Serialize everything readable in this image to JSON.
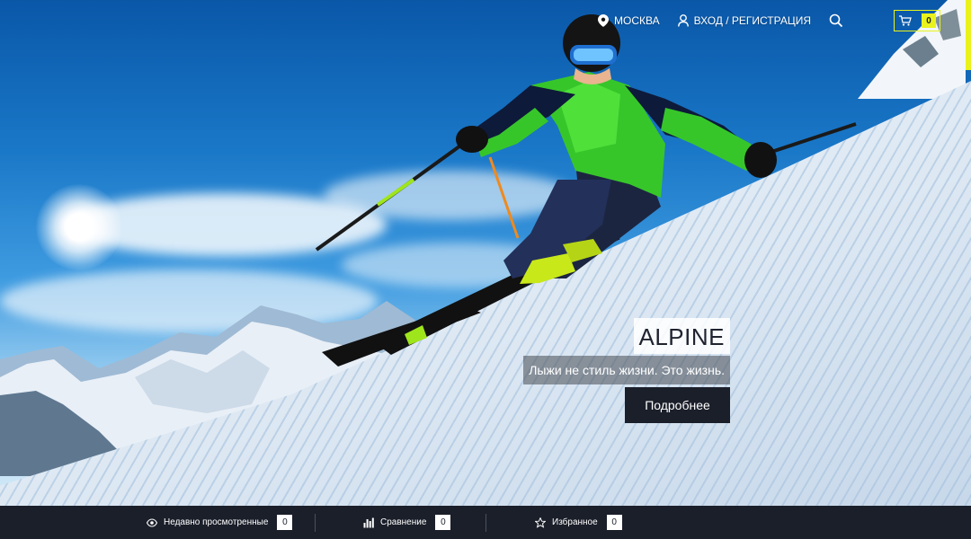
{
  "header": {
    "city": "МОСКВА",
    "login": "ВХОД / РЕГИСТРАЦИЯ",
    "cart_count": "0",
    "icons": [
      "location-pin-icon",
      "user-icon",
      "search-icon",
      "cart-icon"
    ],
    "accent_color": "#e9f21c"
  },
  "promo": {
    "title": "ALPINE",
    "subtitle": "Лыжи не стиль жизни. Это жизнь.",
    "button": "Подробнее"
  },
  "bottom_bar": {
    "background": "#1b1f2a",
    "items": [
      {
        "icon": "eye-icon",
        "label": "Недавно просмотренные",
        "count": "0"
      },
      {
        "icon": "bar-chart-icon",
        "label": "Сравнение",
        "count": "0"
      },
      {
        "icon": "star-icon",
        "label": "Избранное",
        "count": "0"
      }
    ]
  }
}
